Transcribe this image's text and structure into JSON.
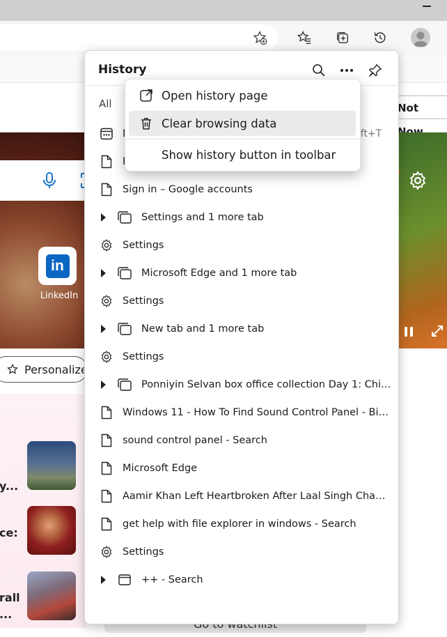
{
  "browser": {
    "profile_icon": "person-icon"
  },
  "page": {
    "not_now_label": "Not Now",
    "linkedin_logo_text": "in",
    "linkedin_label": "LinkedIn",
    "personalize_label": "Personalize",
    "news_snippets": [
      "y...",
      "ce:",
      "rall",
      "..."
    ],
    "bottom_button_label": "Go to watchlist"
  },
  "history": {
    "title": "History",
    "tab_all": "All",
    "shortcut_hint": "hift+T",
    "items": [
      {
        "type": "site",
        "icon": "calendar-icon",
        "label": "N"
      },
      {
        "type": "page",
        "icon": "page-icon",
        "label": "E"
      },
      {
        "type": "page",
        "icon": "page-icon",
        "label": "Sign in – Google accounts"
      },
      {
        "type": "group",
        "icon": "tabs-icon",
        "label": "Settings and 1 more tab"
      },
      {
        "type": "settings",
        "icon": "gear-icon",
        "label": "Settings"
      },
      {
        "type": "group",
        "icon": "tabs-icon",
        "label": "Microsoft Edge and 1 more tab"
      },
      {
        "type": "settings",
        "icon": "gear-icon",
        "label": "Settings"
      },
      {
        "type": "group",
        "icon": "tabs-icon",
        "label": "New tab and 1 more tab"
      },
      {
        "type": "settings",
        "icon": "gear-icon",
        "label": "Settings"
      },
      {
        "type": "group",
        "icon": "tabs-icon",
        "label": "Ponniyin Selvan box office collection Day 1: Chiyaa..."
      },
      {
        "type": "page",
        "icon": "page-icon",
        "label": "Windows 11 - How To Find Sound Control Panel - Bing v..."
      },
      {
        "type": "page",
        "icon": "page-icon",
        "label": "sound control panel - Search"
      },
      {
        "type": "page",
        "icon": "page-icon",
        "label": "Microsoft Edge"
      },
      {
        "type": "page",
        "icon": "page-icon",
        "label": "Aamir Khan Left Heartbroken After Laal Singh Chaddha ..."
      },
      {
        "type": "page",
        "icon": "page-icon",
        "label": "get help with file explorer in windows - Search"
      },
      {
        "type": "settings",
        "icon": "gear-icon",
        "label": "Settings"
      },
      {
        "type": "group",
        "icon": "tab-icon",
        "label": "++ - Search"
      }
    ]
  },
  "context_menu": {
    "items": [
      {
        "icon": "open-external-icon",
        "label": "Open history page"
      },
      {
        "icon": "trash-icon",
        "label": "Clear browsing data"
      },
      {
        "icon": "",
        "label": "Show history button in toolbar"
      }
    ]
  }
}
